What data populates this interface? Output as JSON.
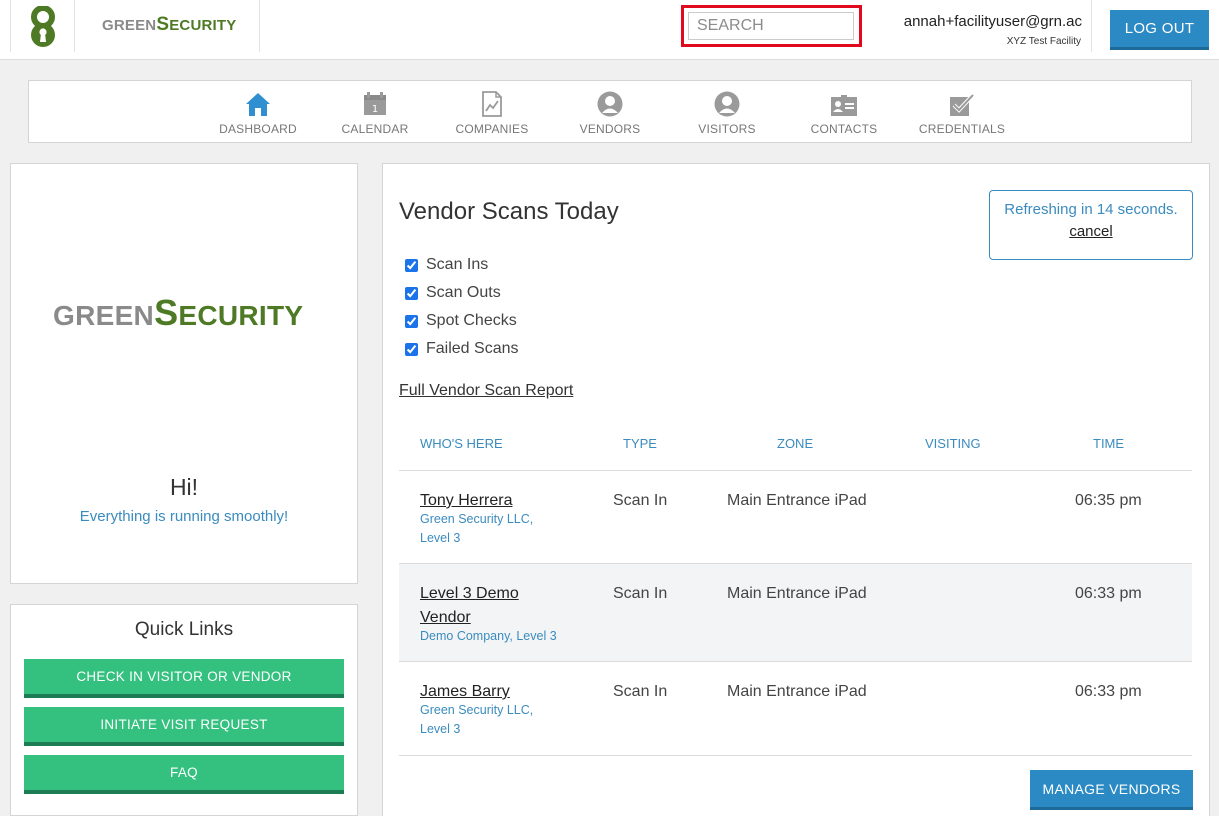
{
  "header": {
    "brand_prefix": "GREEN",
    "brand_suffix": "ECURITY",
    "search_placeholder": "SEARCH",
    "user_email": "annah+facilityuser@grn.ac",
    "facility": "XYZ Test Facility",
    "logout_label": "LOG OUT"
  },
  "nav": {
    "items": [
      {
        "label": "DASHBOARD",
        "icon": "home-icon",
        "active": true
      },
      {
        "label": "CALENDAR",
        "icon": "calendar-icon",
        "calendar_day": "1"
      },
      {
        "label": "COMPANIES",
        "icon": "companies-icon"
      },
      {
        "label": "VENDORS",
        "icon": "vendor-person-icon"
      },
      {
        "label": "VISITORS",
        "icon": "visitor-person-icon"
      },
      {
        "label": "CONTACTS",
        "icon": "contact-card-icon"
      },
      {
        "label": "CREDENTIALS",
        "icon": "credential-check-icon"
      }
    ]
  },
  "welcome": {
    "brand_prefix": "GREEN",
    "brand_suffix": "ECURITY",
    "greeting": "Hi!",
    "status": "Everything is running smoothly!"
  },
  "quick_links": {
    "title": "Quick Links",
    "buttons": [
      "CHECK IN VISITOR OR VENDOR",
      "INITIATE VISIT REQUEST",
      "FAQ"
    ]
  },
  "main": {
    "title": "Vendor Scans Today",
    "refresh_text": "Refreshing in 14 seconds.",
    "refresh_cancel": "cancel",
    "filters": [
      {
        "label": "Scan Ins",
        "checked": true
      },
      {
        "label": "Scan Outs",
        "checked": true
      },
      {
        "label": "Spot Checks",
        "checked": true
      },
      {
        "label": "Failed Scans",
        "checked": true
      }
    ],
    "report_link": "Full Vendor Scan Report",
    "columns": [
      "WHO'S HERE",
      "TYPE",
      "ZONE",
      "VISITING",
      "TIME"
    ],
    "rows": [
      {
        "name": "Tony Herrera",
        "company": "Green Security LLC, Level 3",
        "type": "Scan In",
        "zone": "Main Entrance iPad",
        "visiting": "",
        "time": "06:35 pm"
      },
      {
        "name": "Level 3 Demo Vendor",
        "company": "Demo Company, Level 3",
        "type": "Scan In",
        "zone": "Main Entrance iPad",
        "visiting": "",
        "time": "06:33 pm"
      },
      {
        "name": "James Barry",
        "company": "Green Security LLC, Level 3",
        "type": "Scan In",
        "zone": "Main Entrance iPad",
        "visiting": "",
        "time": "06:33 pm"
      }
    ],
    "manage_label": "MANAGE VENDORS"
  },
  "colors": {
    "brand_green": "#4e7a25",
    "brand_gray": "#8a8a8a",
    "primary_blue": "#2b8ac4",
    "link_blue": "#3a8bbf",
    "action_green": "#34c180",
    "search_highlight": "#e0091d"
  }
}
